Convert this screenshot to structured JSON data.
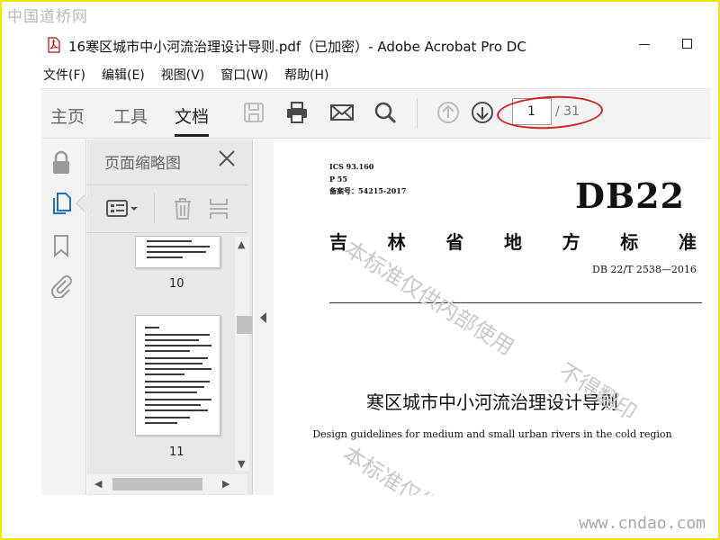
{
  "overlay": {
    "logo_text": "中国道桥网",
    "url_text": "www.cndao.com"
  },
  "window": {
    "title": "16寒区城市中小河流治理设计导则.pdf（已加密）- Adobe Acrobat Pro DC"
  },
  "menu": {
    "items": [
      "文件(F)",
      "编辑(E)",
      "视图(V)",
      "窗口(W)",
      "帮助(H)"
    ]
  },
  "toolbar": {
    "tabs": [
      "主页",
      "工具",
      "文档"
    ],
    "active_tab": "文档",
    "current_page": "1",
    "page_total": "/ 31"
  },
  "panel": {
    "title": "页面缩略图",
    "thumbnails": [
      {
        "label": "10"
      },
      {
        "label": "11"
      }
    ]
  },
  "document": {
    "ics": "ICS 93.160",
    "p": "P 55",
    "record_no": "备案号：54215-2017",
    "code": "DB22",
    "province_chars": [
      "吉",
      "林",
      "省",
      "地",
      "方",
      "标",
      "准"
    ],
    "standard_no": "DB 22/T 2538—2016",
    "title_cn": "寒区城市中小河流治理设计导则",
    "title_en": "Design guidelines for medium and small urban rivers in the cold region",
    "watermarks": [
      "本标准仅供内部使用",
      "不得翻印",
      "本标准仅供"
    ]
  },
  "colors": {
    "frame_border": "#f2e600",
    "annotation_ring": "#d81e1e",
    "icon_active_blue": "#1a73c8"
  }
}
